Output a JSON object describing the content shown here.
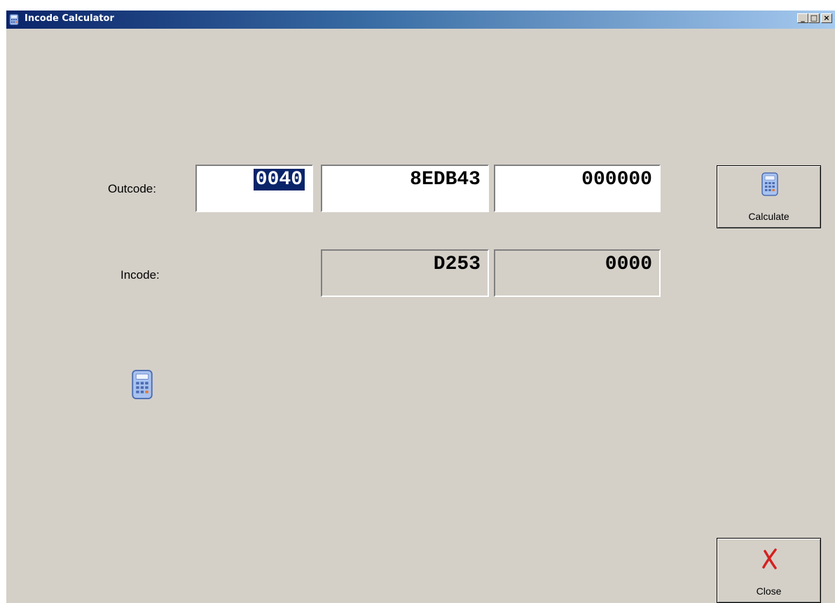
{
  "window": {
    "title": "Incode Calculator",
    "controls": {
      "minimize": "_",
      "maximize": "□",
      "close": "×"
    }
  },
  "outcode": {
    "label": "Outcode:",
    "fields": [
      "0040",
      "8EDB43",
      "000000"
    ]
  },
  "incode": {
    "label": "Incode:",
    "fields": [
      "D253",
      "0000"
    ]
  },
  "buttons": {
    "calculate": {
      "label": "Calculate",
      "icon": "calculator-icon"
    },
    "close": {
      "label": "Close",
      "icon": "red-x-icon"
    }
  },
  "decor": {
    "icon": "calculator-icon"
  },
  "colors": {
    "window_bg": "#d4d0c8",
    "title_start": "#0a246a",
    "title_end": "#a6caf0",
    "selection": "#0a246a",
    "close_icon": "#d52020"
  }
}
